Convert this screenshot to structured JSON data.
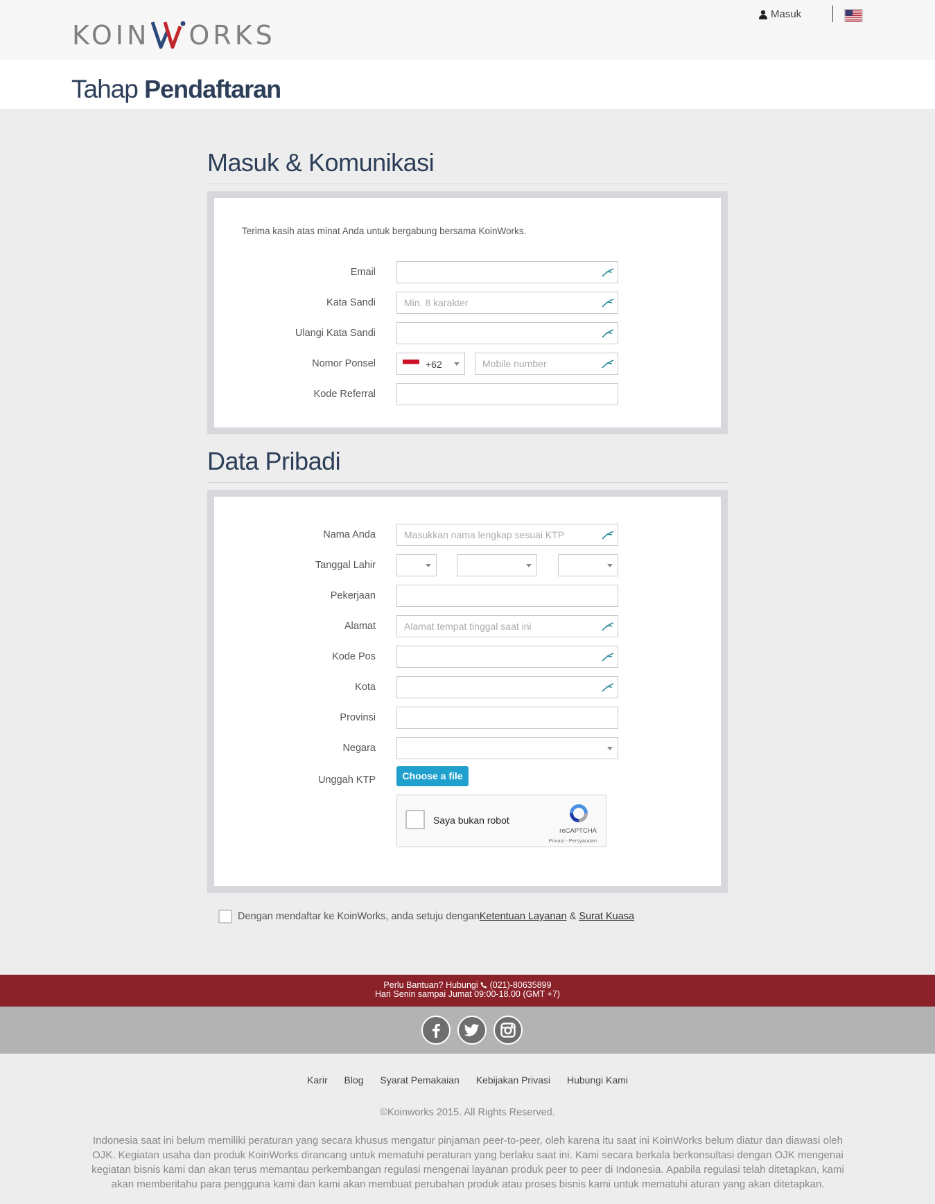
{
  "header": {
    "logo_left": "KOIN",
    "logo_right": "ORKS",
    "login_label": "Masuk"
  },
  "page_title": {
    "light": "Tahap ",
    "bold": "Pendaftaran"
  },
  "section1": {
    "title": "Masuk & Komunikasi",
    "intro": "Terima kasih atas minat Anda untuk bergabung bersama KoinWorks.",
    "email_label": "Email",
    "password_label": "Kata Sandi",
    "password_placeholder": "Min. 8 karakter",
    "repeat_password_label": "Ulangi Kata Sandi",
    "phone_label": "Nomor Ponsel",
    "phone_code": "+62",
    "phone_placeholder": "Mobile number",
    "referral_label": "Kode Referral"
  },
  "section2": {
    "title": "Data Pribadi",
    "name_label": "Nama Anda",
    "name_placeholder": "Masukkan nama lengkap sesuai KTP",
    "dob_label": "Tanggal Lahir",
    "job_label": "Pekerjaan",
    "address_label": "Alamat",
    "address_placeholder": "Alamat tempat tinggal saat ini",
    "postal_label": "Kode Pos",
    "city_label": "Kota",
    "province_label": "Provinsi",
    "country_label": "Negara",
    "upload_label": "Unggah KTP",
    "upload_button": "Choose a file",
    "captcha_text": "Saya bukan robot",
    "captcha_brand": "reCAPTCHA",
    "captcha_links": "Privasi - Persyaratan"
  },
  "agreement": {
    "text": "Dengan mendaftar ke KoinWorks, anda setuju dengan ",
    "terms_link": "Ketentuan Layanan ",
    "amp": " & ",
    "poa_link": "Surat Kuasa"
  },
  "footer": {
    "help_line1_prefix": "Perlu Bantuan? Hubungi ",
    "help_phone": "(021)-80635899",
    "help_line2": "Hari Senin sampai Jumat 09:00-18.00 (GMT +7)",
    "links": [
      "Karir",
      "Blog",
      "Syarat Pemakaian",
      "Kebijakan Privasi",
      "Hubungi Kami"
    ],
    "copyright": "©Koinworks 2015. All Rights Reserved.",
    "disclaimer": "Indonesia saat ini belum memiliki peraturan yang secara khusus mengatur pinjaman peer-to-peer, oleh karena itu saat ini KoinWorks belum diatur dan diawasi oleh OJK. Kegiatan usaha dan produk KoinWorks dirancang untuk mematuhi peraturan yang berlaku saat ini. Kami secara berkala berkonsultasi dengan OJK mengenai kegiatan bisnis kami dan akan terus memantau perkembangan regulasi mengenai layanan produk peer to peer di Indonesia. Apabila regulasi telah ditetapkan, kami akan memberitahu para pengguna kami dan kami akan membuat perubahan produk atau proses bisnis kami untuk mematuhi aturan yang akan ditetapkan."
  },
  "icons": {
    "user": "user-icon",
    "flag_us": "us-flag-icon",
    "flag_id": "indonesia-flag-icon",
    "autofill": "autofill-pen-icon",
    "phone": "phone-icon",
    "facebook": "facebook-icon",
    "twitter": "twitter-icon",
    "instagram": "instagram-icon"
  },
  "colors": {
    "brand_navy": "#2c3e58",
    "help_band": "#8b2129",
    "button_blue": "#20a0cd",
    "logo_red": "#c0272d",
    "logo_blue": "#2c4a7c"
  }
}
